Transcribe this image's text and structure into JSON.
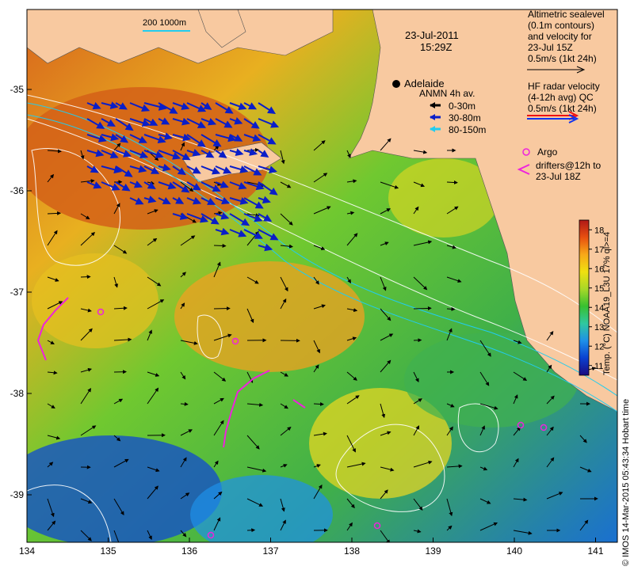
{
  "map": {
    "date": "23-Jul-2011",
    "time": "15:29Z",
    "place_label": "Adelaide",
    "scale_label": "200  1000m",
    "x_ticks": [
      "134",
      "135",
      "136",
      "137",
      "138",
      "139",
      "140",
      "141"
    ],
    "y_ticks": [
      "-35",
      "-36",
      "-37",
      "-38",
      "-39"
    ],
    "colors": {
      "land": "#f8c9a0",
      "anmn_shallow": "#000000",
      "anmn_mid": "#0a1ec8",
      "anmn_deep": "#22ccee",
      "argo": "#ee22dd",
      "hf_radar_red": "#ee1111",
      "hf_radar_blue": "#1133ee"
    }
  },
  "legend": {
    "altimetric": [
      "Altimetric sealevel",
      "(0.1m contours)",
      "and velocity for",
      "23-Jul 15Z",
      "0.5m/s (1kt 24h)"
    ],
    "hf_radar": [
      "HF radar velocity",
      "(4-12h avg) ",
      "0.5m/s (1kt 24h)"
    ],
    "hf_radar_qc": "QC",
    "anmn_title": "ANMN 4h av.",
    "anmn_items": [
      "0-30m",
      "30-80m",
      "80-150m"
    ],
    "argo_label": "Argo",
    "drifters": [
      "drifters@12h to",
      "23-Jul 18Z"
    ]
  },
  "colorbar": {
    "ticks": [
      "18",
      "17",
      "16",
      "15",
      "14",
      "13",
      "12",
      "11"
    ],
    "min": 10.5,
    "max": 18.5,
    "title": "Temp. (°C) NOAA19_L3U 17% ql>=4",
    "stops": [
      "#1a0a80",
      "#0a40d0",
      "#1e90e8",
      "#30c8a0",
      "#38c030",
      "#a8d828",
      "#f0e010",
      "#f8a818",
      "#e85010",
      "#b01818"
    ]
  },
  "credit": "© IMOS 14-Mar-2015 05:43:34 Hobart time"
}
